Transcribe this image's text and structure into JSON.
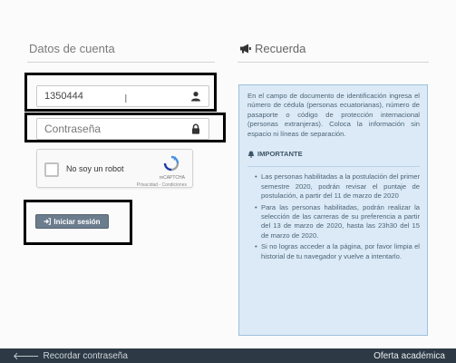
{
  "account": {
    "title": "Datos de cuenta",
    "cedula_value": "1350444",
    "password_placeholder": "Contraseña"
  },
  "captcha": {
    "label": "No soy un robot",
    "brand": "reCAPTCHA",
    "terms": "Privacidad - Condiciones"
  },
  "login_button": {
    "label": "Iniciar sesión"
  },
  "reminder": {
    "title": "Recuerda",
    "intro": "En el campo de documento de identificación ingresa el número de cédula (personas ecuatorianas), número de pasaporte o código de protección internacional (personas extranjeras). Coloca la información sin espacio ni líneas de separación.",
    "important_label": "IMPORTANTE",
    "bullets": [
      "Las personas habilitadas a la postulación del primer semestre 2020, podrán revisar el puntaje de postulación, a partir del 11 de marzo de 2020",
      "Para las personas habilitadas, podrán realizar la selección de las carreras de su preferencia a partir del 13 de marzo de 2020, hasta las 23h30 del 15 de marzo de 2020.",
      "Si no logras acceder a la página, por favor limpia el historial de tu navegador y vuelve a intentarlo."
    ]
  },
  "footer": {
    "forgot_password": "Recordar contraseña",
    "academic_offer": "Oferta académica"
  }
}
